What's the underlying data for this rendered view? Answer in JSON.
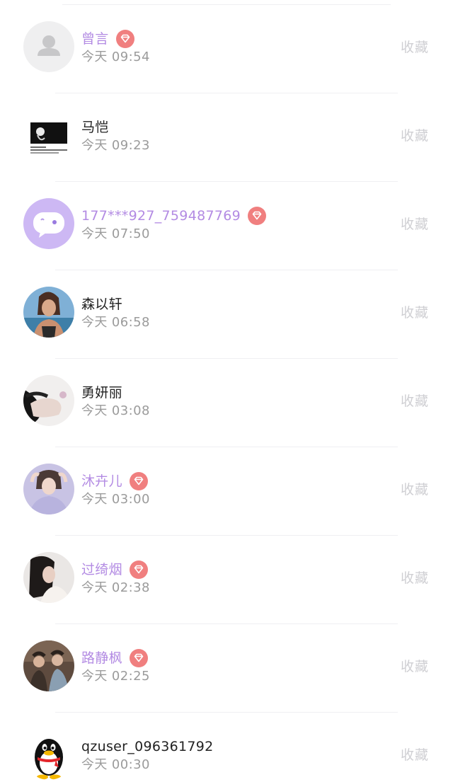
{
  "colors": {
    "vip_name": "#b38be3",
    "normal_name": "#222222",
    "time_text": "#9b9b9b",
    "favorite_text": "#cfcfd3",
    "vip_badge": "#f07f7f",
    "divider": "#efeff2"
  },
  "visitors": [
    {
      "name": "曾言",
      "time": "今天 09:54",
      "vip": true,
      "avatar": "default-person-avatar",
      "favorite_label": "收藏"
    },
    {
      "name": "马恺",
      "time": "今天 09:23",
      "vip": false,
      "avatar": "dark-photo-avatar",
      "favorite_label": "收藏"
    },
    {
      "name": "177***927_759487769",
      "time": "今天 07:50",
      "vip": true,
      "avatar": "chat-bubble-avatar",
      "favorite_label": "收藏"
    },
    {
      "name": "森以轩",
      "time": "今天 06:58",
      "vip": false,
      "avatar": "photo-avatar",
      "favorite_label": "收藏"
    },
    {
      "name": "勇妍丽",
      "time": "今天 03:08",
      "vip": false,
      "avatar": "photo-avatar",
      "favorite_label": "收藏"
    },
    {
      "name": "沐卉儿",
      "time": "今天 03:00",
      "vip": true,
      "avatar": "photo-avatar",
      "favorite_label": "收藏"
    },
    {
      "name": "过绮烟",
      "time": "今天 02:38",
      "vip": true,
      "avatar": "photo-avatar",
      "favorite_label": "收藏"
    },
    {
      "name": "路静枫",
      "time": "今天 02:25",
      "vip": true,
      "avatar": "photo-avatar",
      "favorite_label": "收藏"
    },
    {
      "name": "qzuser_096361792",
      "time": "今天 00:30",
      "vip": false,
      "avatar": "penguin-avatar",
      "favorite_label": "收藏"
    }
  ]
}
